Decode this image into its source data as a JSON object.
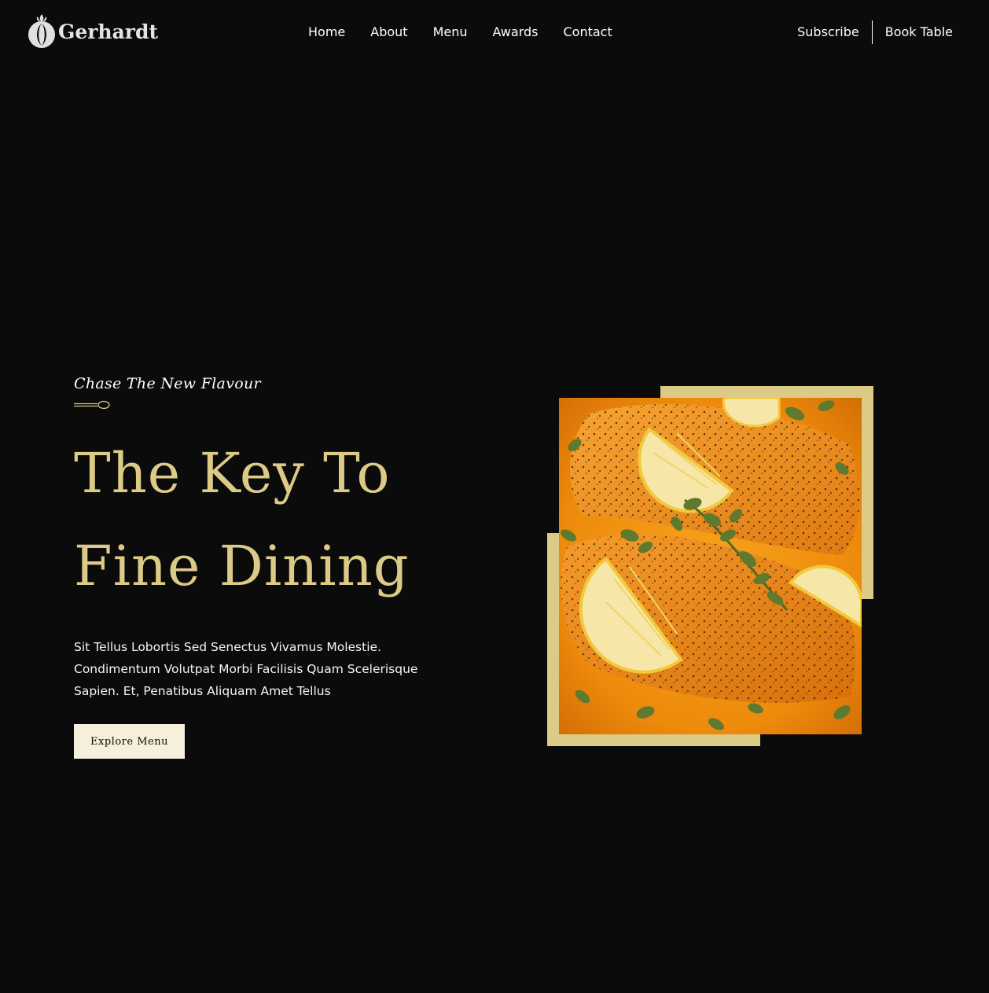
{
  "header": {
    "logo_text": "Gerhardt",
    "nav": [
      {
        "label": "Home"
      },
      {
        "label": "About"
      },
      {
        "label": "Menu"
      },
      {
        "label": "Awards"
      },
      {
        "label": "Contact"
      }
    ],
    "actions": {
      "subscribe": "Subscribe",
      "book_table": "Book Table"
    }
  },
  "hero": {
    "tagline": "Chase The New Flavour",
    "title_line1": "The Key To",
    "title_line2": "Fine Dining",
    "description": "Sit Tellus Lobortis Sed Senectus Vivamus Molestie. Condimentum Volutpat Morbi Facilisis Quam Scelerisque Sapien. Et, Penatibus Aliquam Amet Tellus",
    "cta_label": "Explore Menu"
  },
  "colors": {
    "background": "#0b0b0b",
    "gold": "#dcca87",
    "cream": "#f5efdb",
    "text": "#ffffff"
  },
  "icons": {
    "logo": "gerhardt-logo-icon",
    "divider": "spoon-icon"
  }
}
